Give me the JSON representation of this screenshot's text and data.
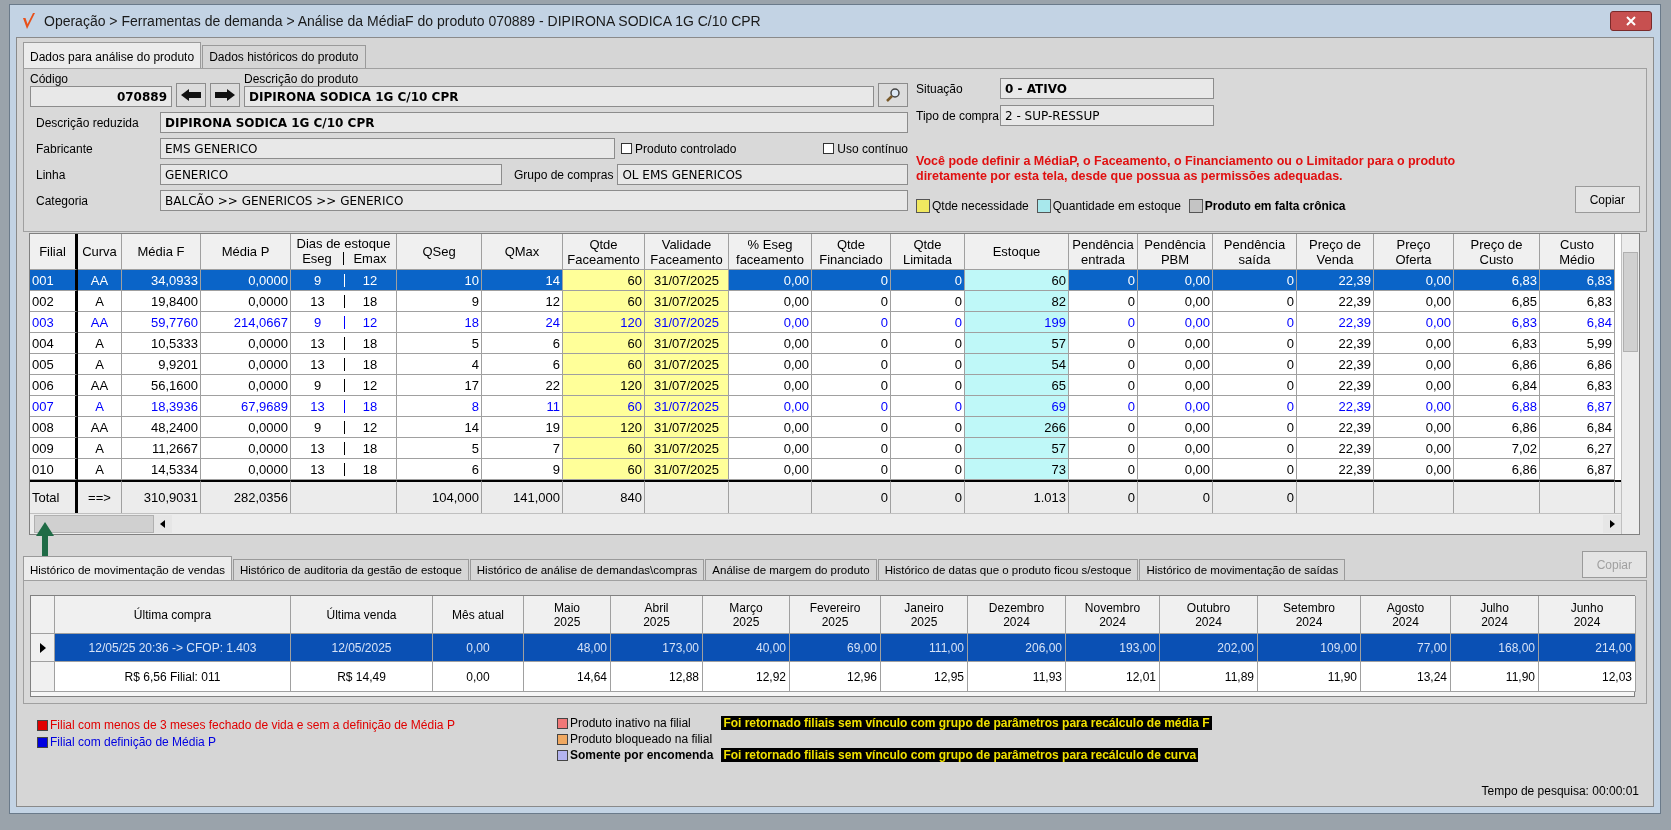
{
  "window": {
    "title": "Operação > Ferramentas de demanda > Análise da MédiaF do produto 070889 - DIPIRONA SODICA 1G C/10 CPR"
  },
  "tabs": [
    {
      "label": "Dados para análise do produto",
      "selected": true
    },
    {
      "label": "Dados históricos do produto",
      "selected": false
    }
  ],
  "product": {
    "codigo_label": "Código",
    "codigo": "070889",
    "descricao_label": "Descrição do produto",
    "descricao": "DIPIRONA SODICA 1G C/10 CPR",
    "situacao_label": "Situação",
    "situacao": "0 - ATIVO",
    "tipo_compra_label": "Tipo de compra",
    "tipo_compra": "2 - SUP-RESSUP",
    "descricao_reduzida_label": "Descrição reduzida",
    "descricao_reduzida": "DIPIRONA SODICA 1G C/10 CPR",
    "fabricante_label": "Fabricante",
    "fabricante": "EMS GENERICO",
    "linha_label": "Linha",
    "linha": "GENERICO",
    "grupo_label": "Grupo de compras",
    "grupo": "OL EMS GENERICOS",
    "categoria_label": "Categoria",
    "categoria": "BALCÃO >> GENERICOS >> GENERICO"
  },
  "checkboxes": [
    {
      "label": "Produto controlado",
      "checked": false
    },
    {
      "label": "Uso contínuo",
      "checked": false
    }
  ],
  "notice": "Você pode definir a MédiaP, o Faceamento, o Financiamento ou o Limitador para o produto diretamente por esta tela, desde que possua as permissões adequadas.",
  "legend": [
    {
      "label": "Qtde necessidade",
      "color": "#f0e860",
      "bold": false
    },
    {
      "label": "Quantidade em estoque",
      "color": "#a8e8ec",
      "bold": false
    },
    {
      "label": "Produto em falta crônica",
      "color": "#c4c4c4",
      "bold": true
    }
  ],
  "copy_button": "Copiar",
  "table": {
    "columns": [
      {
        "label": "Filial",
        "kind": "plain"
      },
      {
        "label": "Curva",
        "kind": "plain"
      },
      {
        "label": "Média F",
        "kind": "plain"
      },
      {
        "label": "Média P",
        "kind": "plain"
      },
      {
        "label": "Eseg",
        "kind": "group_start",
        "group": "Dias de estoque"
      },
      {
        "label": "Emax",
        "kind": "group_end"
      },
      {
        "label": "QSeg",
        "kind": "plain"
      },
      {
        "label": "QMax",
        "kind": "plain"
      },
      {
        "label": "Qtde\nFaceamento",
        "kind": "plain",
        "color": "#ffff99"
      },
      {
        "label": "Validade\nFaceamento",
        "kind": "plain",
        "color": "#ffff99"
      },
      {
        "label": "% Eseg\nfaceamento",
        "kind": "plain"
      },
      {
        "label": "Qtde\nFinanciado",
        "kind": "plain"
      },
      {
        "label": "Qtde\nLimitada",
        "kind": "plain"
      },
      {
        "label": "Estoque",
        "kind": "plain",
        "color": "#bff8f8"
      },
      {
        "label": "Pendência\nentrada",
        "kind": "plain"
      },
      {
        "label": "Pendência\nPBM",
        "kind": "plain"
      },
      {
        "label": "Pendência\nsaída",
        "kind": "plain"
      },
      {
        "label": "Preço de\nVenda",
        "kind": "plain"
      },
      {
        "label": "Preço\nOferta",
        "kind": "plain"
      },
      {
        "label": "Preço de\nCusto",
        "kind": "plain"
      },
      {
        "label": "Custo\nMédio",
        "kind": "plain"
      }
    ],
    "rows": [
      {
        "selected": true,
        "color": "#000000",
        "cells": [
          "001",
          "AA",
          "34,0933",
          "0,0000",
          "9",
          "12",
          "10",
          "14",
          "60",
          "31/07/2025",
          "0,00",
          "0",
          "0",
          "60",
          "0",
          "0,00",
          "0",
          "22,39",
          "0,00",
          "6,83",
          "6,83"
        ]
      },
      {
        "selected": false,
        "color": "#000000",
        "cells": [
          "002",
          "A",
          "19,8400",
          "0,0000",
          "13",
          "18",
          "9",
          "12",
          "60",
          "31/07/2025",
          "0,00",
          "0",
          "0",
          "82",
          "0",
          "0,00",
          "0",
          "22,39",
          "0,00",
          "6,85",
          "6,83"
        ]
      },
      {
        "selected": false,
        "color": "#0000ff",
        "cells": [
          "003",
          "AA",
          "59,7760",
          "214,0667",
          "9",
          "12",
          "18",
          "24",
          "120",
          "31/07/2025",
          "0,00",
          "0",
          "0",
          "199",
          "0",
          "0,00",
          "0",
          "22,39",
          "0,00",
          "6,83",
          "6,84"
        ]
      },
      {
        "selected": false,
        "color": "#000000",
        "cells": [
          "004",
          "A",
          "10,5333",
          "0,0000",
          "13",
          "18",
          "5",
          "6",
          "60",
          "31/07/2025",
          "0,00",
          "0",
          "0",
          "57",
          "0",
          "0,00",
          "0",
          "22,39",
          "0,00",
          "6,83",
          "5,99"
        ]
      },
      {
        "selected": false,
        "color": "#000000",
        "cells": [
          "005",
          "A",
          "9,9201",
          "0,0000",
          "13",
          "18",
          "4",
          "6",
          "60",
          "31/07/2025",
          "0,00",
          "0",
          "0",
          "54",
          "0",
          "0,00",
          "0",
          "22,39",
          "0,00",
          "6,86",
          "6,86"
        ]
      },
      {
        "selected": false,
        "color": "#000000",
        "cells": [
          "006",
          "AA",
          "56,1600",
          "0,0000",
          "9",
          "12",
          "17",
          "22",
          "120",
          "31/07/2025",
          "0,00",
          "0",
          "0",
          "65",
          "0",
          "0,00",
          "0",
          "22,39",
          "0,00",
          "6,84",
          "6,83"
        ]
      },
      {
        "selected": false,
        "color": "#0000ff",
        "cells": [
          "007",
          "A",
          "18,3936",
          "67,9689",
          "13",
          "18",
          "8",
          "11",
          "60",
          "31/07/2025",
          "0,00",
          "0",
          "0",
          "69",
          "0",
          "0,00",
          "0",
          "22,39",
          "0,00",
          "6,88",
          "6,87"
        ]
      },
      {
        "selected": false,
        "color": "#000000",
        "cells": [
          "008",
          "AA",
          "48,2400",
          "0,0000",
          "9",
          "12",
          "14",
          "19",
          "120",
          "31/07/2025",
          "0,00",
          "0",
          "0",
          "266",
          "0",
          "0,00",
          "0",
          "22,39",
          "0,00",
          "6,86",
          "6,84"
        ]
      },
      {
        "selected": false,
        "color": "#000000",
        "cells": [
          "009",
          "A",
          "11,2667",
          "0,0000",
          "13",
          "18",
          "5",
          "7",
          "60",
          "31/07/2025",
          "0,00",
          "0",
          "0",
          "57",
          "0",
          "0,00",
          "0",
          "22,39",
          "0,00",
          "7,02",
          "6,27"
        ]
      },
      {
        "selected": false,
        "color": "#000000",
        "cells": [
          "010",
          "A",
          "14,5334",
          "0,0000",
          "13",
          "18",
          "6",
          "9",
          "60",
          "31/07/2025",
          "0,00",
          "0",
          "0",
          "73",
          "0",
          "0,00",
          "0",
          "22,39",
          "0,00",
          "6,86",
          "6,87"
        ]
      }
    ],
    "total": [
      {
        "kind": "value",
        "text": "Total"
      },
      {
        "kind": "value",
        "text": "==>"
      },
      {
        "kind": "value",
        "text": "310,9031"
      },
      {
        "kind": "value",
        "text": "282,0356"
      },
      {
        "kind": "empty"
      },
      {
        "kind": "empty"
      },
      {
        "kind": "value",
        "text": "104,000"
      },
      {
        "kind": "value",
        "text": "141,000"
      },
      {
        "kind": "value",
        "text": "840"
      },
      {
        "kind": "empty"
      },
      {
        "kind": "empty"
      },
      {
        "kind": "value",
        "text": "0"
      },
      {
        "kind": "value",
        "text": "0"
      },
      {
        "kind": "value",
        "text": "1.013"
      },
      {
        "kind": "value",
        "text": "0"
      },
      {
        "kind": "value",
        "text": "0"
      },
      {
        "kind": "value",
        "text": "0"
      },
      {
        "kind": "empty"
      },
      {
        "kind": "empty"
      },
      {
        "kind": "empty"
      },
      {
        "kind": "empty"
      }
    ]
  },
  "history": {
    "tabs": [
      {
        "label": "Histórico de movimentação de vendas",
        "selected": true
      },
      {
        "label": "Histórico de auditoria da gestão de estoque",
        "selected": false
      },
      {
        "label": "Histórico de análise de demandas\\compras",
        "selected": false
      },
      {
        "label": "Análise de margem do produto",
        "selected": false
      },
      {
        "label": "Histórico de datas que o produto ficou s/estoque",
        "selected": false
      },
      {
        "label": "Histórico de movimentação de saídas",
        "selected": false
      }
    ],
    "copy_button": {
      "label": "Copiar",
      "disabled": true
    },
    "columns": [
      "Última compra",
      "Última venda",
      "Mês atual",
      "Maio\n2025",
      "Abril\n2025",
      "Março\n2025",
      "Fevereiro\n2025",
      "Janeiro\n2025",
      "Dezembro\n2024",
      "Novembro\n2024",
      "Outubro\n2024",
      "Setembro\n2024",
      "Agosto\n2024",
      "Julho\n2024",
      "Junho\n2024"
    ],
    "rows": [
      {
        "selected": true,
        "cells": [
          "12/05/25 20:36 -> CFOP: 1.403",
          "12/05/2025",
          "0,00",
          "48,00",
          "173,00",
          "40,00",
          "69,00",
          "111,00",
          "206,00",
          "193,00",
          "202,00",
          "109,00",
          "77,00",
          "168,00",
          "214,00"
        ]
      },
      {
        "selected": false,
        "cells": [
          "R$ 6,56 Filial: 011",
          "R$ 14,49",
          "0,00",
          "14,64",
          "12,88",
          "12,92",
          "12,96",
          "12,95",
          "11,93",
          "12,01",
          "11,89",
          "11,90",
          "13,24",
          "11,90",
          "12,03"
        ]
      }
    ]
  },
  "legend_left": [
    {
      "label": "Filial com menos de 3 meses fechado de vida e sem a definição de Média P",
      "color": "#e00000"
    },
    {
      "label": "Filial com definição de Média P",
      "color": "#0000e0"
    }
  ],
  "legend_mid": [
    {
      "label": "Produto inativo na filial",
      "color": "#f07878",
      "bold": false
    },
    {
      "label": "Produto bloqueado na filial",
      "color": "#f0a860",
      "bold": false
    },
    {
      "label": "Somente por encomenda",
      "color": "#b4b4f0",
      "bold": true
    }
  ],
  "warnings": [
    "Foi retornado filiais sem vínculo com grupo de parâmetros para recálculo de média F",
    "Foi retornado filiais sem vínculo com grupo de parâmetros para recálculo de curva"
  ],
  "search_time": "Tempo de pesquisa: 00:00:01"
}
